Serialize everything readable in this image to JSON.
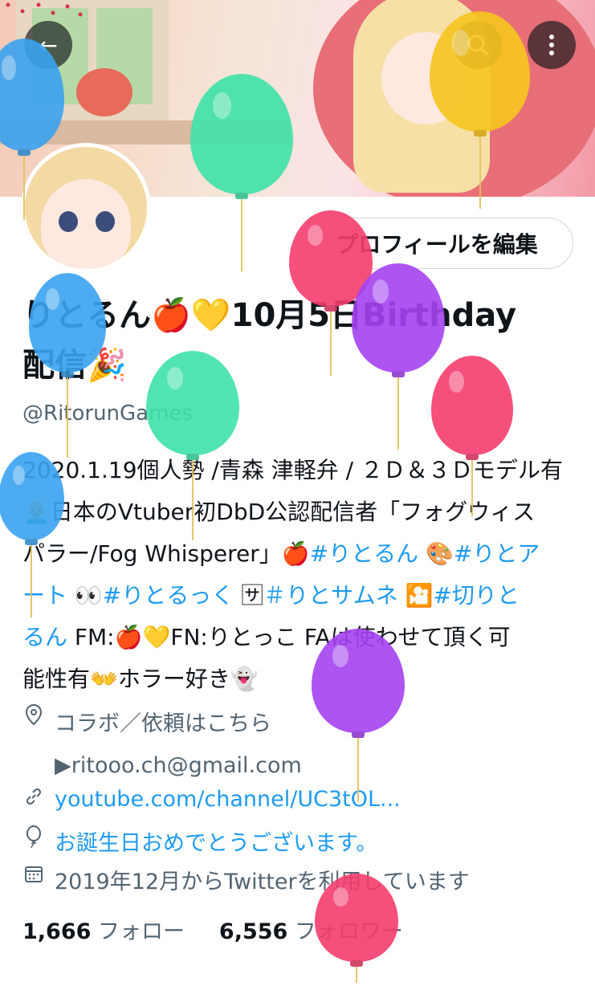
{
  "header": {
    "back_icon": "arrow-left-icon",
    "search_icon": "search-icon",
    "more_icon": "more-vertical-icon"
  },
  "profile": {
    "edit_button": "プロフィールを編集",
    "name_line1": "りとるん🍎💛10月5日Birthday",
    "name_line2": "配信🎉",
    "handle": "@RitorunGames"
  },
  "bio": {
    "line1": "2020.1.19個人勢 /青森 津軽弁 / ２Ｄ＆３Ｄモデル有",
    "line2": "👨‍🦲日本のVtuber初DbD公認配信者「フォグウィス",
    "line3_pre": "パラー/Fog Whisperer」🍎",
    "tag1": "#りとるん",
    "sep1": " 🎨",
    "tag2": "#りとア",
    "line4_tag2_cont": "ート",
    "sep2": " 👀",
    "tag3": "#りとるっく",
    "sep3": " 🈂",
    "tag4": "＃りとサムネ",
    "sep4": " 🎦",
    "tag5": "#切りと",
    "line5_tag5_cont": "るん",
    "line5_post": " FM:🍎💛FN:りとっこ FAは使わせて頂く可",
    "line6": "能性有👐ホラー好き👻"
  },
  "meta": {
    "location_icon": "location-pin-icon",
    "location_line1": "コラボ／依頼はこちら",
    "location_line2": "▶ritooo.ch@gmail.com",
    "link_icon": "link-icon",
    "link_text": "youtube.com/channel/UC3tOL...",
    "birthday_icon": "balloon-icon",
    "birthday_text": "お誕生日おめでとうございます。",
    "joined_icon": "calendar-icon",
    "joined_text": "2019年12月からTwitterを利用しています"
  },
  "stats": {
    "following_count": "1,666",
    "following_label": "フォロー",
    "followers_count": "6,556",
    "followers_label": "フォロワー"
  },
  "colors": {
    "accent": "#1d9bf0",
    "text": "#0f1419",
    "muted": "#536471",
    "balloon_blue": "#3aa3f0",
    "balloon_green": "#3ee2a8",
    "balloon_red": "#f43e6e",
    "balloon_purple": "#a542f0",
    "balloon_yellow": "#f7c61e"
  }
}
